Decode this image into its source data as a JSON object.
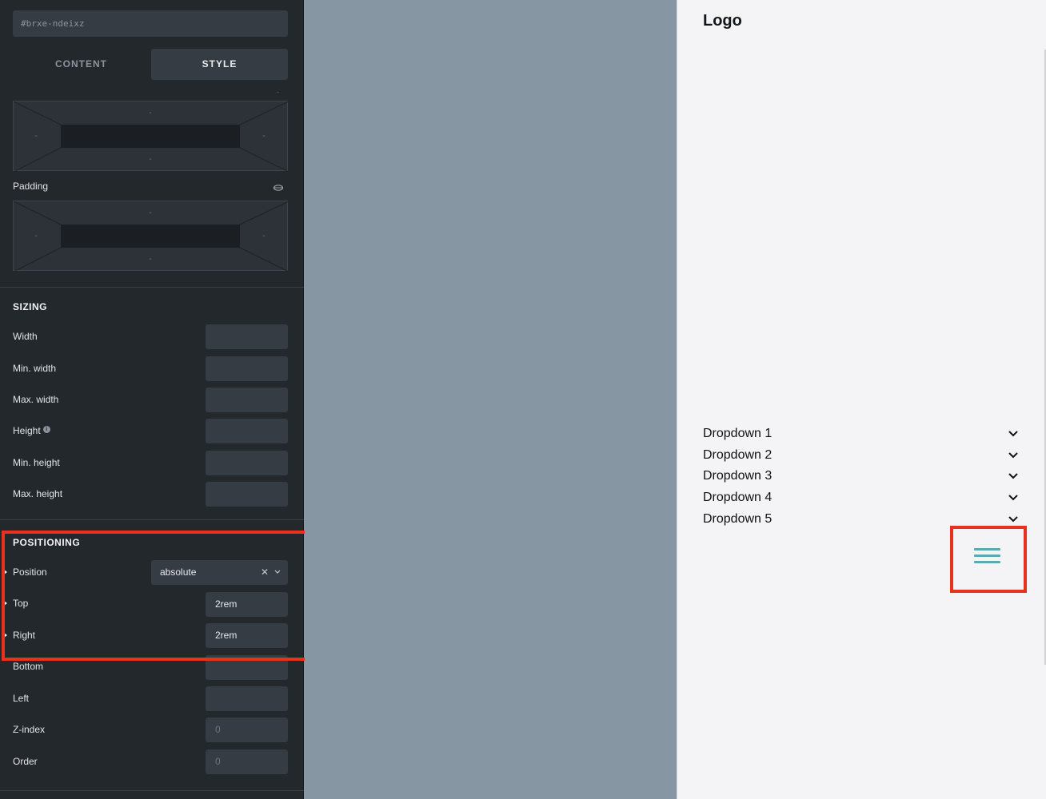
{
  "panel": {
    "element_id": "#brxe-ndeixz",
    "tabs": [
      {
        "label": "CONTENT"
      },
      {
        "label": "STYLE"
      }
    ],
    "margin_box": {
      "top": "-",
      "right": "-",
      "bottom": "-",
      "left": "-"
    },
    "padding_label": "Padding",
    "padding_box": {
      "top": "-",
      "right": "-",
      "bottom": "-",
      "left": "-"
    },
    "sizing": {
      "title": "SIZING",
      "width_label": "Width",
      "min_width_label": "Min. width",
      "max_width_label": "Max. width",
      "height_label": "Height",
      "min_height_label": "Min. height",
      "max_height_label": "Max. height"
    },
    "positioning": {
      "title": "POSITIONING",
      "position_label": "Position",
      "position_value": "absolute",
      "top_label": "Top",
      "top_value": "2rem",
      "right_label": "Right",
      "right_value": "2rem",
      "bottom_label": "Bottom",
      "left_label": "Left",
      "zindex_label": "Z-index",
      "zindex_placeholder": "0",
      "order_label": "Order",
      "order_placeholder": "0"
    }
  },
  "preview": {
    "logo": "Logo",
    "dropdowns": [
      {
        "label": "Dropdown 1"
      },
      {
        "label": "Dropdown 2"
      },
      {
        "label": "Dropdown 3"
      },
      {
        "label": "Dropdown 4"
      },
      {
        "label": "Dropdown 5"
      }
    ],
    "accent_color": "#5ea7b4",
    "highlight_color": "#e8321e"
  }
}
